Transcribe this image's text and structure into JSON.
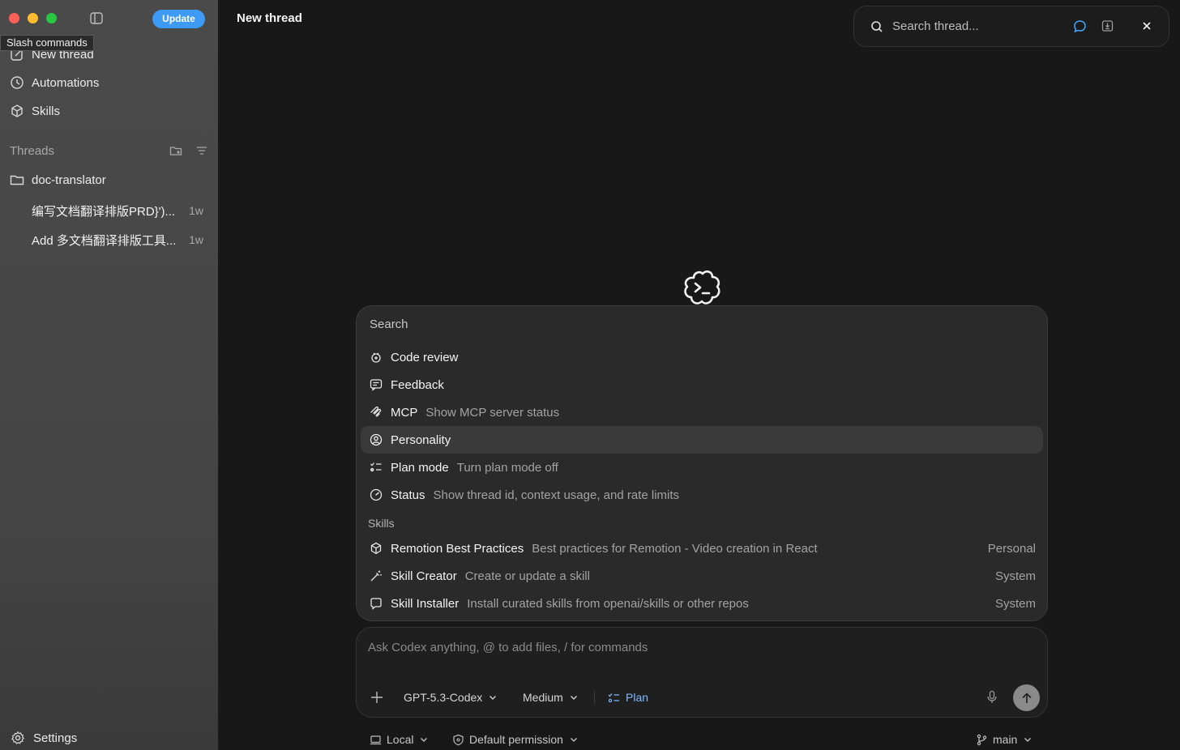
{
  "window": {
    "update_label": "Update",
    "tooltip": "Slash commands"
  },
  "sidebar": {
    "nav": [
      {
        "label": "New thread",
        "icon": "edit-icon"
      },
      {
        "label": "Automations",
        "icon": "clock-icon"
      },
      {
        "label": "Skills",
        "icon": "cube-icon"
      }
    ],
    "threads_label": "Threads",
    "project": {
      "label": "doc-translator",
      "icon": "folder-icon"
    },
    "threads": [
      {
        "title": "编写文档翻译排版PRD}')...",
        "time": "1w"
      },
      {
        "title": "Add 多文档翻译排版工具...",
        "time": "1w"
      }
    ],
    "settings_label": "Settings"
  },
  "main": {
    "title": "New thread"
  },
  "search": {
    "placeholder": "Search thread..."
  },
  "palette": {
    "search_placeholder": "Search",
    "commands": [
      {
        "name": "Code review",
        "desc": "",
        "icon": "bug-icon"
      },
      {
        "name": "Feedback",
        "desc": "",
        "icon": "message-square-icon"
      },
      {
        "name": "MCP",
        "desc": "Show MCP server status",
        "icon": "mcp-icon"
      },
      {
        "name": "Personality",
        "desc": "",
        "icon": "user-circle-icon",
        "selected": true
      },
      {
        "name": "Plan mode",
        "desc": "Turn plan mode off",
        "icon": "checklist-icon"
      },
      {
        "name": "Status",
        "desc": "Show thread id, context usage, and rate limits",
        "icon": "gauge-icon"
      }
    ],
    "skills_label": "Skills",
    "skills": [
      {
        "name": "Remotion Best Practices",
        "desc": "Best practices for Remotion - Video creation in React",
        "scope": "Personal",
        "icon": "cube-icon"
      },
      {
        "name": "Skill Creator",
        "desc": "Create or update a skill",
        "scope": "System",
        "icon": "wand-icon"
      },
      {
        "name": "Skill Installer",
        "desc": "Install curated skills from openai/skills or other repos",
        "scope": "System",
        "icon": "install-icon"
      }
    ]
  },
  "composer": {
    "placeholder": "Ask Codex anything, @ to add files, / for commands",
    "model": "GPT-5.3-Codex",
    "effort": "Medium",
    "plan_label": "Plan"
  },
  "footer": {
    "local_label": "Local",
    "permission_label": "Default permission",
    "branch_label": "main"
  },
  "colors": {
    "accent": "#3d9bf5",
    "plan_accent": "#7fb8ff",
    "sidebar_bg": "#474747",
    "main_bg": "#181818",
    "palette_bg": "#2a2a2a"
  }
}
